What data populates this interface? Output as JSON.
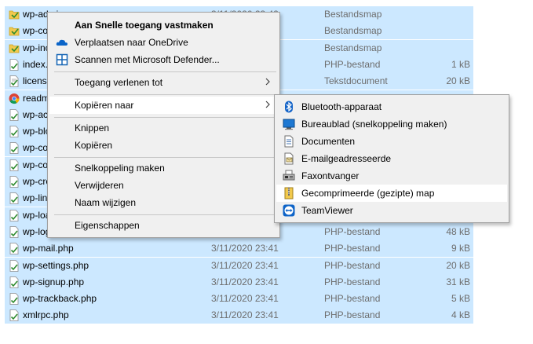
{
  "files": [
    {
      "name": "wp-admin",
      "date": "3/11/2020 23:42",
      "type": "Bestandsmap",
      "size": "",
      "icon": "folder-icon"
    },
    {
      "name": "wp-content",
      "date": "",
      "type": "Bestandsmap",
      "size": "",
      "icon": "folder-icon"
    },
    {
      "name": "wp-includes",
      "date": "",
      "type": "Bestandsmap",
      "size": "",
      "icon": "folder-icon"
    },
    {
      "name": "index.php",
      "date": "",
      "type": "PHP-bestand",
      "size": "1 kB",
      "icon": "php-file-icon"
    },
    {
      "name": "license.txt",
      "date": "",
      "type": "Tekstdocument",
      "size": "20 kB",
      "icon": "text-file-icon"
    },
    {
      "name": "readme.html",
      "date": "",
      "type": "",
      "size": "",
      "icon": "chrome-html-icon"
    },
    {
      "name": "wp-activate.php",
      "date": "",
      "type": "",
      "size": "",
      "icon": "php-file-icon"
    },
    {
      "name": "wp-blog-header.php",
      "date": "",
      "type": "",
      "size": "",
      "icon": "php-file-icon"
    },
    {
      "name": "wp-comments-post.php",
      "date": "",
      "type": "",
      "size": "",
      "icon": "php-file-icon"
    },
    {
      "name": "wp-config.php",
      "date": "",
      "type": "",
      "size": "",
      "icon": "php-file-icon"
    },
    {
      "name": "wp-cron.php",
      "date": "",
      "type": "",
      "size": "",
      "icon": "php-file-icon"
    },
    {
      "name": "wp-links-opml.php",
      "date": "",
      "type": "",
      "size": "",
      "icon": "php-file-icon"
    },
    {
      "name": "wp-load.php",
      "date": "",
      "type": "",
      "size": "",
      "icon": "php-file-icon"
    },
    {
      "name": "wp-login.php",
      "date": "",
      "type": "PHP-bestand",
      "size": "48 kB",
      "icon": "php-file-icon"
    },
    {
      "name": "wp-mail.php",
      "date": "3/11/2020 23:41",
      "type": "PHP-bestand",
      "size": "9 kB",
      "icon": "php-file-icon"
    },
    {
      "name": "wp-settings.php",
      "date": "3/11/2020 23:41",
      "type": "PHP-bestand",
      "size": "20 kB",
      "icon": "php-file-icon"
    },
    {
      "name": "wp-signup.php",
      "date": "3/11/2020 23:41",
      "type": "PHP-bestand",
      "size": "31 kB",
      "icon": "php-file-icon"
    },
    {
      "name": "wp-trackback.php",
      "date": "3/11/2020 23:41",
      "type": "PHP-bestand",
      "size": "5 kB",
      "icon": "php-file-icon"
    },
    {
      "name": "xmlrpc.php",
      "date": "3/11/2020 23:41",
      "type": "PHP-bestand",
      "size": "4 kB",
      "icon": "php-file-icon"
    }
  ],
  "context_menu": {
    "pin_quick_access": "Aan Snelle toegang vastmaken",
    "move_onedrive": "Verplaatsen naar OneDrive",
    "scan_defender": "Scannen met Microsoft Defender...",
    "give_access": "Toegang verlenen tot",
    "copy_to": "Kopiëren naar",
    "cut": "Knippen",
    "copy": "Kopiëren",
    "create_shortcut": "Snelkoppeling maken",
    "delete": "Verwijderen",
    "rename": "Naam wijzigen",
    "properties": "Eigenschappen"
  },
  "submenu": {
    "bluetooth": "Bluetooth-apparaat",
    "desktop": "Bureaublad (snelkoppeling maken)",
    "documents": "Documenten",
    "mail_recipient": "E-mailgeadresseerde",
    "fax": "Faxontvanger",
    "zip": "Gecomprimeerde (gezipte) map",
    "teamviewer": "TeamViewer"
  },
  "colors": {
    "selection": "#cce8ff",
    "menu_bg": "#f0f0f0",
    "menu_highlight": "#ffffff",
    "secondary_text": "#6d6d6d"
  }
}
